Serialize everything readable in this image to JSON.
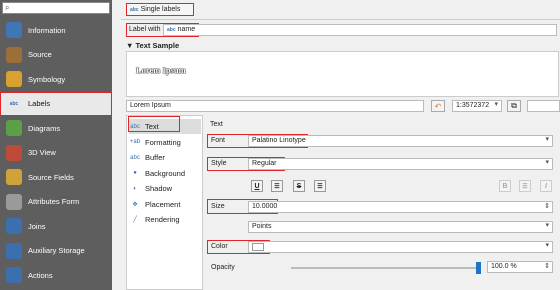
{
  "sidebar": {
    "search_placeholder": "",
    "items": [
      {
        "label": "Information",
        "icon": "info-icon",
        "color": "#3f76b5"
      },
      {
        "label": "Source",
        "icon": "wrench-icon",
        "color": "#9c6e3a"
      },
      {
        "label": "Symbology",
        "icon": "brush-icon",
        "color": "#d9a12f"
      },
      {
        "label": "Labels",
        "icon": "abc-label-icon",
        "color": "#e8e8e8"
      },
      {
        "label": "Diagrams",
        "icon": "diagram-icon",
        "color": "#5aa046"
      },
      {
        "label": "3D View",
        "icon": "cube-icon",
        "color": "#c04a3a"
      },
      {
        "label": "Source Fields",
        "icon": "table-icon",
        "color": "#cfa23a"
      },
      {
        "label": "Attributes Form",
        "icon": "form-icon",
        "color": "#9a9a9a"
      },
      {
        "label": "Joins",
        "icon": "join-icon",
        "color": "#3b6fb0"
      },
      {
        "label": "Auxiliary Storage",
        "icon": "database-icon",
        "color": "#3b6fb0"
      },
      {
        "label": "Actions",
        "icon": "gear-icon",
        "color": "#3b6fb0"
      }
    ]
  },
  "mode": {
    "label": "Single labels",
    "icon": "abc-icon"
  },
  "label_with": {
    "label": "Label with",
    "value": "name",
    "icon": "abc-icon"
  },
  "text_sample": {
    "title": "▼ Text Sample",
    "preview": "Lorem Ipsum",
    "input": "Lorem Ipsum",
    "scale": "1:3572372"
  },
  "tabs": [
    {
      "label": "Text",
      "icon": "abc"
    },
    {
      "label": "Formatting",
      "icon": "+ab"
    },
    {
      "label": "Buffer",
      "icon": "abc"
    },
    {
      "label": "Background",
      "icon": "●"
    },
    {
      "label": "Shadow",
      "icon": "◐"
    },
    {
      "label": "Placement",
      "icon": "✥"
    },
    {
      "label": "Rendering",
      "icon": "╱"
    }
  ],
  "text_settings": {
    "heading": "Text",
    "font_label": "Font",
    "font_value": "Palatino Linotype",
    "style_label": "Style",
    "style_value": "Regular",
    "size_label": "Size",
    "size_value": "10.0000",
    "unit_value": "Points",
    "color_label": "Color",
    "color_value": "#ffffff",
    "opacity_label": "Opacity",
    "opacity_value": "100.0 %",
    "opacity_fraction": 1.0
  },
  "toolbar": {
    "underline": "U",
    "strike": "S",
    "bold": "B",
    "italic": "I"
  },
  "colors": {
    "highlight": "#e0252d",
    "sidebar_bg": "#5e5e5e",
    "accent": "#1f74c8"
  }
}
